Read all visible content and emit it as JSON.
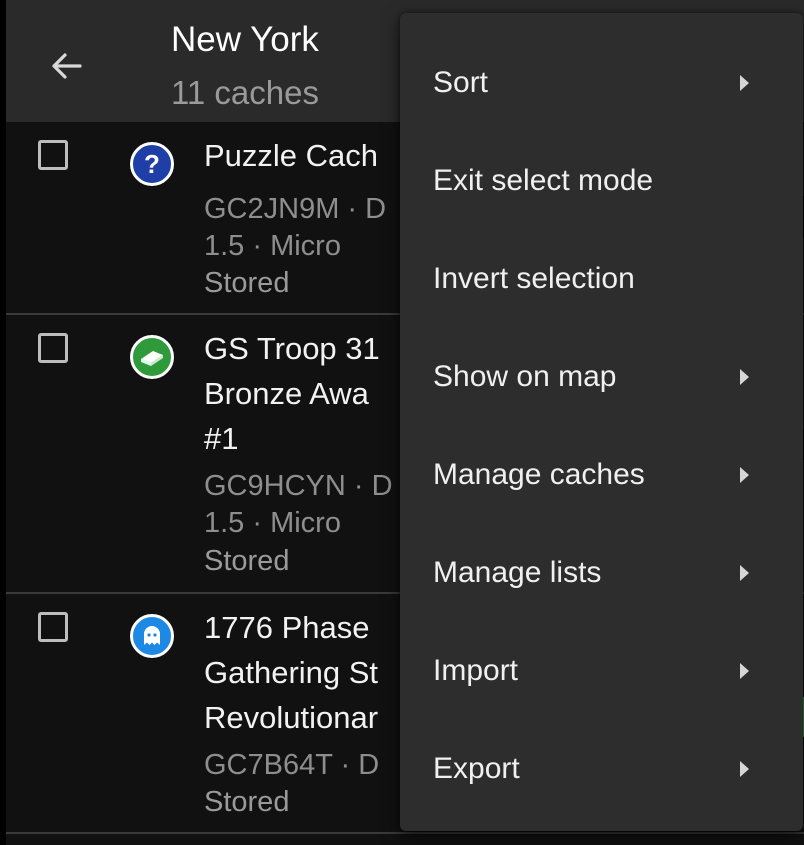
{
  "header": {
    "title": "New York",
    "subtitle": "11 caches"
  },
  "caches": [
    {
      "title_lines": [
        "Puzzle Cach"
      ],
      "detail_lines": [
        "GC2JN9M · D",
        "1.5 · Micro"
      ],
      "status": "Stored",
      "icon": "question-mark-icon",
      "icon_color": "#1f3fa6"
    },
    {
      "title_lines": [
        "GS Troop 31",
        "Bronze Awa",
        "#1"
      ],
      "detail_lines": [
        "GC9HCYN · D",
        "1.5 · Micro"
      ],
      "status": "Stored",
      "icon": "traditional-box-icon",
      "icon_color": "#2e9a3a"
    },
    {
      "title_lines": [
        "1776 Phase",
        "Gathering St",
        "Revolutionar"
      ],
      "detail_lines": [
        "GC7B64T · D"
      ],
      "status": "Stored",
      "icon": "ghost-icon",
      "icon_color": "#1e88e5"
    }
  ],
  "menu": {
    "items": [
      {
        "label": "Sort",
        "submenu": true
      },
      {
        "label": "Exit select mode",
        "submenu": false
      },
      {
        "label": "Invert selection",
        "submenu": false
      },
      {
        "label": "Show on map",
        "submenu": true
      },
      {
        "label": "Manage caches",
        "submenu": true
      },
      {
        "label": "Manage lists",
        "submenu": true
      },
      {
        "label": "Import",
        "submenu": true
      },
      {
        "label": "Export",
        "submenu": true
      }
    ]
  },
  "colors": {
    "app_bar": "#2a2a2a",
    "list_background": "#111111",
    "menu_background": "#2d2d2d",
    "stored_stripe": "#2aa83a"
  }
}
